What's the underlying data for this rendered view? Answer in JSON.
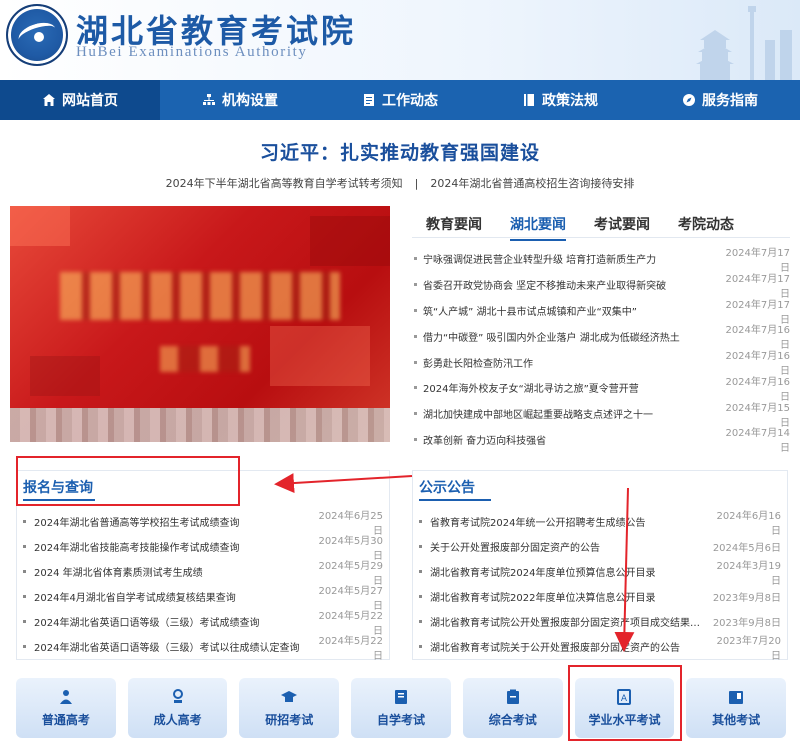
{
  "header": {
    "title": "湖北省教育考试院",
    "subtitle": "HuBei Examinations Authority",
    "logo_text": "湖北省教育考试院"
  },
  "nav": {
    "items": [
      {
        "label": "网站首页",
        "icon": "home-icon",
        "active": true
      },
      {
        "label": "机构设置",
        "icon": "org-chart-icon",
        "active": false
      },
      {
        "label": "工作动态",
        "icon": "document-icon",
        "active": false
      },
      {
        "label": "政策法规",
        "icon": "book-icon",
        "active": false
      },
      {
        "label": "服务指南",
        "icon": "compass-icon",
        "active": false
      }
    ]
  },
  "headline": {
    "title": "习近平：扎实推动教育强国建设",
    "link1": "2024年下半年湖北省高等教育自学考试转考须知",
    "separator": "|",
    "link2": "2024年湖北省普通高校招生咨询接待安排"
  },
  "news": {
    "tabs": [
      "教育要闻",
      "湖北要闻",
      "考试要闻",
      "考院动态"
    ],
    "active_tab": "湖北要闻",
    "items": [
      {
        "title": "宁咏强调促进民营企业转型升级 培育打造新质生产力",
        "date": "2024年7月17日"
      },
      {
        "title": "省委召开政党协商会 坚定不移推动未来产业取得新突破",
        "date": "2024年7月17日"
      },
      {
        "title": "筑“人产城” 湖北十县市试点城镇和产业“双集中”",
        "date": "2024年7月17日"
      },
      {
        "title": "借力“中碳登” 吸引国内外企业落户 湖北成为低碳经济热土",
        "date": "2024年7月16日"
      },
      {
        "title": "彭勇赴长阳检查防汛工作",
        "date": "2024年7月16日"
      },
      {
        "title": "2024年海外校友子女“湖北寻访之旅”夏令营开营",
        "date": "2024年7月16日"
      },
      {
        "title": "湖北加快建成中部地区崛起重要战略支点述评之十一",
        "date": "2024年7月15日"
      },
      {
        "title": "改革创新 奋力迈向科技强省",
        "date": "2024年7月14日"
      }
    ]
  },
  "registration": {
    "title": "报名与查询",
    "items": [
      {
        "title": "2024年湖北省普通高等学校招生考试成绩查询",
        "date": "2024年6月25日"
      },
      {
        "title": "2024年湖北省技能高考技能操作考试成绩查询",
        "date": "2024年5月30日"
      },
      {
        "title": "2024 年湖北省体育素质测试考生成绩",
        "date": "2024年5月29日"
      },
      {
        "title": "2024年4月湖北省自学考试成绩复核结果查询",
        "date": "2024年5月27日"
      },
      {
        "title": "2024年湖北省英语口语等级（三级）考试成绩查询",
        "date": "2024年5月22日"
      },
      {
        "title": "2024年湖北省英语口语等级（三级）考试以往成绩认定查询",
        "date": "2024年5月22日"
      }
    ]
  },
  "announcements": {
    "title": "公示公告",
    "items": [
      {
        "title": "省教育考试院2024年统一公开招聘考生成绩公告",
        "date": "2024年6月16日"
      },
      {
        "title": "关于公开处置报废部分固定资产的公告",
        "date": "2024年5月6日"
      },
      {
        "title": "湖北省教育考试院2024年度单位预算信息公开目录",
        "date": "2024年3月19日"
      },
      {
        "title": "湖北省教育考试院2022年度单位决算信息公开目录",
        "date": "2023年9月8日"
      },
      {
        "title": "湖北省教育考试院公开处置报废部分固定资产项目成交结果…",
        "date": "2023年9月8日"
      },
      {
        "title": "湖北省教育考试院关于公开处置报废部分固定资产的公告",
        "date": "2023年7月20日"
      }
    ]
  },
  "quick_links": [
    {
      "label": "普通高考",
      "icon": "student-icon"
    },
    {
      "label": "成人高考",
      "icon": "adult-icon"
    },
    {
      "label": "研招考试",
      "icon": "graduation-cap-icon"
    },
    {
      "label": "自学考试",
      "icon": "book-open-icon"
    },
    {
      "label": "综合考试",
      "icon": "clipboard-icon"
    },
    {
      "label": "学业水平考试",
      "icon": "certificate-icon"
    },
    {
      "label": "其他考试",
      "icon": "notebook-icon"
    }
  ],
  "colors": {
    "primary": "#1b63b0",
    "nav_active": "#0e4a8e",
    "title_blue": "#1a4f9c",
    "annotation_red": "#e3242b"
  }
}
